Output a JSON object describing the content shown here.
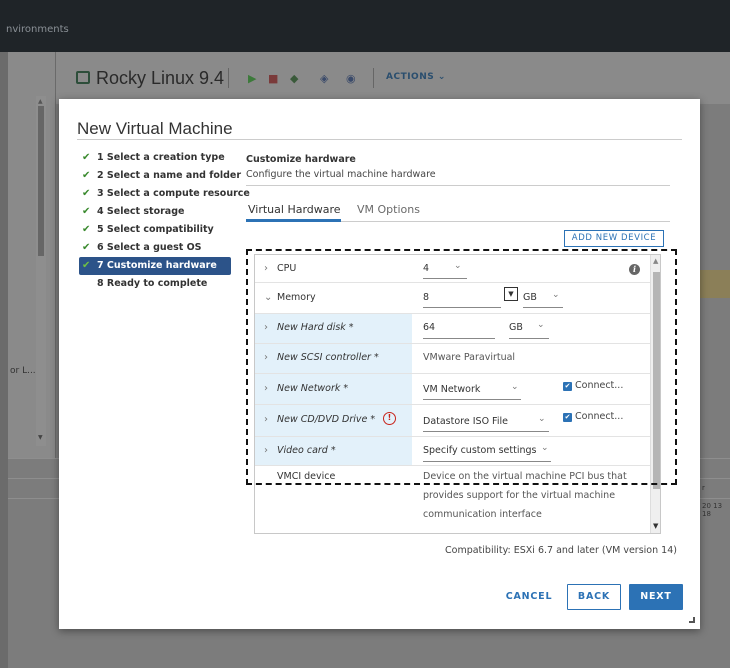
{
  "background": {
    "top_nav_label": "nvironments",
    "vm_title": "Rocky Linux 9.4",
    "actions_label": "ACTIONS",
    "left_partial_text": "or L...",
    "right_partial_text_1": "r",
    "right_partial_text_2": "20 13 18"
  },
  "dialog": {
    "title": "New Virtual Machine",
    "steps": [
      {
        "label": "1 Select a creation type",
        "done": true
      },
      {
        "label": "2 Select a name and folder",
        "done": true
      },
      {
        "label": "3 Select a compute resource",
        "done": true
      },
      {
        "label": "4 Select storage",
        "done": true
      },
      {
        "label": "5 Select compatibility",
        "done": true
      },
      {
        "label": "6 Select a guest OS",
        "done": true
      },
      {
        "label": "7 Customize hardware",
        "done": true,
        "active": true
      },
      {
        "label": "8 Ready to complete",
        "done": false
      }
    ],
    "section_title": "Customize hardware",
    "section_subtitle": "Configure the virtual machine hardware",
    "tabs": [
      {
        "label": "Virtual Hardware",
        "active": true
      },
      {
        "label": "VM Options",
        "active": false
      }
    ],
    "add_device_label": "ADD NEW DEVICE",
    "hardware": {
      "cpu": {
        "label": "CPU",
        "value": "4"
      },
      "memory": {
        "label": "Memory",
        "value": "8",
        "unit": "GB"
      },
      "hard_disk": {
        "label": "New Hard disk *",
        "value": "64",
        "unit": "GB"
      },
      "scsi": {
        "label": "New SCSI controller *",
        "value": "VMware Paravirtual"
      },
      "network": {
        "label": "New Network *",
        "value": "VM Network",
        "connect_label": "Connect...",
        "connected": true
      },
      "cdrom": {
        "label": "New CD/DVD Drive *",
        "value": "Datastore ISO File",
        "connect_label": "Connect...",
        "connected": true,
        "warning": "!"
      },
      "video": {
        "label": "Video card *",
        "value": "Specify custom settings"
      },
      "vmci": {
        "label": "VMCI device",
        "line1": "Device on the virtual machine PCI bus that",
        "line2": "provides support for the virtual machine",
        "line3": "communication interface"
      }
    },
    "compatibility": "Compatibility: ESXi 6.7 and later (VM version 14)",
    "buttons": {
      "cancel": "CANCEL",
      "back": "BACK",
      "next": "NEXT"
    }
  },
  "colors": {
    "accent": "#2c72b5",
    "active_step": "#2c5389",
    "check": "#3a8a2e",
    "warning": "#c8241b"
  }
}
